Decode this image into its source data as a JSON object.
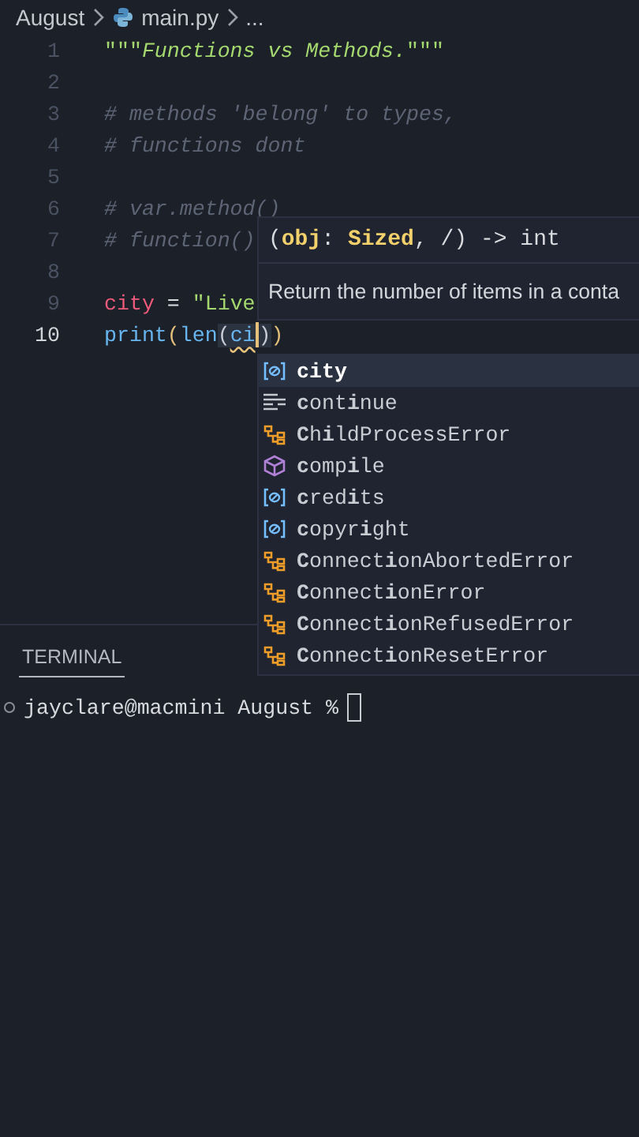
{
  "breadcrumb": [
    {
      "kind": "folder",
      "text": "August"
    },
    {
      "kind": "python-file",
      "text": "main.py"
    },
    {
      "kind": "more",
      "text": "..."
    }
  ],
  "lines": [
    {
      "number": "1",
      "current": false,
      "tokens": [
        {
          "kind": "string",
          "text": "\"\"\""
        },
        {
          "kind": "docstring",
          "text": "Functions vs Methods."
        },
        {
          "kind": "string",
          "text": "\"\"\""
        }
      ]
    },
    {
      "number": "2",
      "current": false
    },
    {
      "number": "3",
      "current": false,
      "tokens": [
        {
          "kind": "comment",
          "text": "# methods 'belong' to types,"
        }
      ]
    },
    {
      "number": "4",
      "current": false,
      "tokens": [
        {
          "kind": "comment",
          "text": "# functions dont"
        }
      ]
    },
    {
      "number": "5",
      "current": false
    },
    {
      "number": "6",
      "current": false,
      "tokens": [
        {
          "kind": "comment",
          "text": "# var.method()"
        }
      ]
    },
    {
      "number": "7",
      "current": false,
      "tokens": [
        {
          "kind": "comment",
          "text": "# function()"
        }
      ]
    },
    {
      "number": "8",
      "current": false
    },
    {
      "number": "9",
      "current": false,
      "tokens": [
        {
          "kind": "variable",
          "text": "city"
        },
        {
          "kind": "plain",
          "text": " = "
        },
        {
          "kind": "string",
          "text": "\"Live"
        }
      ]
    },
    {
      "number": "10",
      "current": true,
      "tokens": [
        {
          "kind": "function",
          "text": "print"
        },
        {
          "kind": "paren",
          "text": "("
        },
        {
          "kind": "function",
          "text": "len"
        },
        {
          "kind": "paren2",
          "text": "("
        },
        {
          "kind": "typing",
          "text": "ci"
        },
        {
          "kind": "paren2",
          "text": ")"
        },
        {
          "kind": "paren",
          "text": ")"
        }
      ]
    }
  ],
  "hover": {
    "signature": [
      {
        "kind": "punct",
        "text": "("
      },
      {
        "kind": "param",
        "text": "obj"
      },
      {
        "kind": "punct",
        "text": ": "
      },
      {
        "kind": "type",
        "text": "Sized"
      },
      {
        "kind": "punct",
        "text": ", /) -> int"
      }
    ],
    "description": "Return the number of items in a conta"
  },
  "suggestions": [
    {
      "kind": "variable",
      "label": "**ci**ty",
      "selected": true
    },
    {
      "kind": "keyword",
      "label": "**c**ont**i**nue",
      "selected": false
    },
    {
      "kind": "class",
      "label": "**C**h**i**ldProcessError",
      "selected": false
    },
    {
      "kind": "module",
      "label": "**c**omp**i**le",
      "selected": false
    },
    {
      "kind": "variable",
      "label": "**c**red**i**ts",
      "selected": false
    },
    {
      "kind": "variable",
      "label": "**c**opyr**i**ght",
      "selected": false
    },
    {
      "kind": "class",
      "label": "**C**onnect**i**onAbortedError",
      "selected": false
    },
    {
      "kind": "class",
      "label": "**C**onnect**i**onError",
      "selected": false
    },
    {
      "kind": "class",
      "label": "**C**onnect**i**onRefusedError",
      "selected": false
    },
    {
      "kind": "class",
      "label": "**C**onnect**i**onResetError",
      "selected": false
    }
  ],
  "panel": {
    "tabs": [
      {
        "label": "TERMINAL",
        "selected": true
      }
    ],
    "prompt": "jayclare@macmini August %"
  }
}
